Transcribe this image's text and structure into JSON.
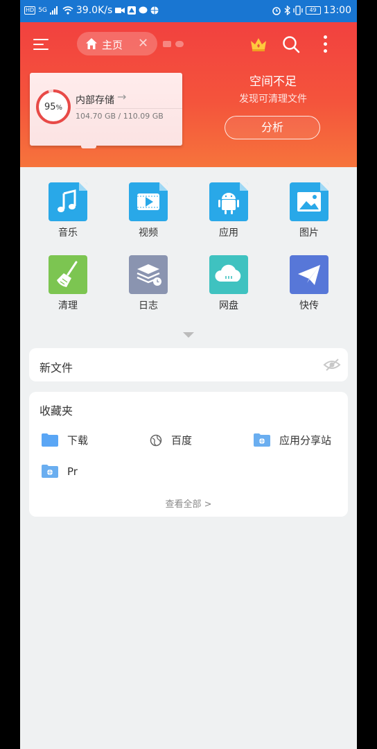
{
  "statusbar": {
    "network_badge": "HD",
    "signal": "5G",
    "speed": "39.0K/s",
    "battery": "49",
    "time": "13:00"
  },
  "header": {
    "tab_home_label": "主页",
    "storage": {
      "percent": "95",
      "percent_unit": "%",
      "percent_value": 0.95,
      "title": "内部存储",
      "size": "104.70 GB / 110.09 GB"
    },
    "space_title": "空间不足",
    "space_subtitle": "发现可清理文件",
    "analyze_label": "分析"
  },
  "categories": [
    {
      "label": "音乐",
      "icon": "music-icon",
      "color": "#29a8e8"
    },
    {
      "label": "视频",
      "icon": "video-icon",
      "color": "#29a8e8"
    },
    {
      "label": "应用",
      "icon": "android-icon",
      "color": "#29a8e8"
    },
    {
      "label": "图片",
      "icon": "image-icon",
      "color": "#29a8e8"
    },
    {
      "label": "清理",
      "icon": "broom-icon",
      "color": "#7cc551"
    },
    {
      "label": "日志",
      "icon": "log-icon",
      "color": "#8a94b0"
    },
    {
      "label": "网盘",
      "icon": "cloud-icon",
      "color": "#3fc2c0"
    },
    {
      "label": "快传",
      "icon": "send-icon",
      "color": "#5777d8"
    }
  ],
  "new_files": {
    "title": "新文件"
  },
  "favorites": {
    "title": "收藏夹",
    "items": [
      {
        "label": "下载",
        "icon": "folder-icon"
      },
      {
        "label": "百度",
        "icon": "globe-icon"
      },
      {
        "label": "应用分享站",
        "icon": "web-folder-icon"
      },
      {
        "label": "Pr",
        "icon": "web-folder-icon"
      }
    ],
    "view_all": "查看全部 >"
  },
  "colors": {
    "statusbar": "#1976d2",
    "header_top": "#f2413f",
    "header_bottom": "#f6743c",
    "ring": "#e84a47"
  }
}
